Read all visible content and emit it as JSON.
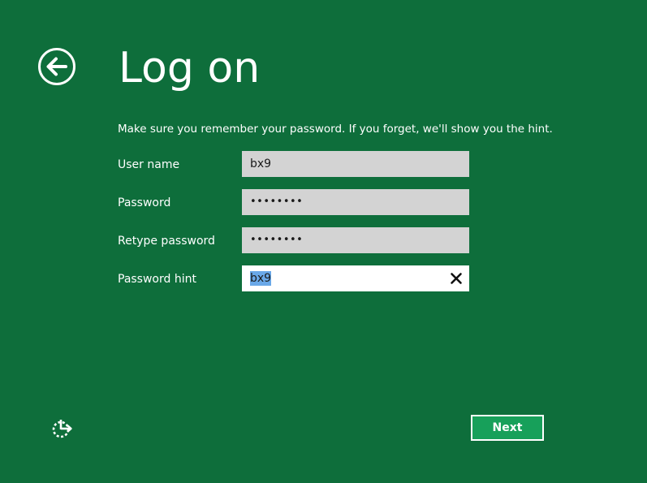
{
  "page": {
    "title": "Log on",
    "instruction": "Make sure you remember your password. If you forget, we'll show you the hint."
  },
  "form": {
    "username": {
      "label": "User name",
      "value": "bx9"
    },
    "password": {
      "label": "Password",
      "value": "••••••••"
    },
    "retype_password": {
      "label": "Retype password",
      "value": "••••••••"
    },
    "password_hint": {
      "label": "Password hint",
      "value": "bx9"
    }
  },
  "buttons": {
    "next_label": "Next"
  },
  "icons": {
    "back": "back-arrow-icon",
    "clear": "close-icon",
    "ease_of_access": "ease-of-access-icon"
  },
  "colors": {
    "background": "#0e6e3b",
    "next_button": "#17a05a",
    "field_background": "#d3d3d3",
    "text_selection": "#6aa8e8"
  }
}
